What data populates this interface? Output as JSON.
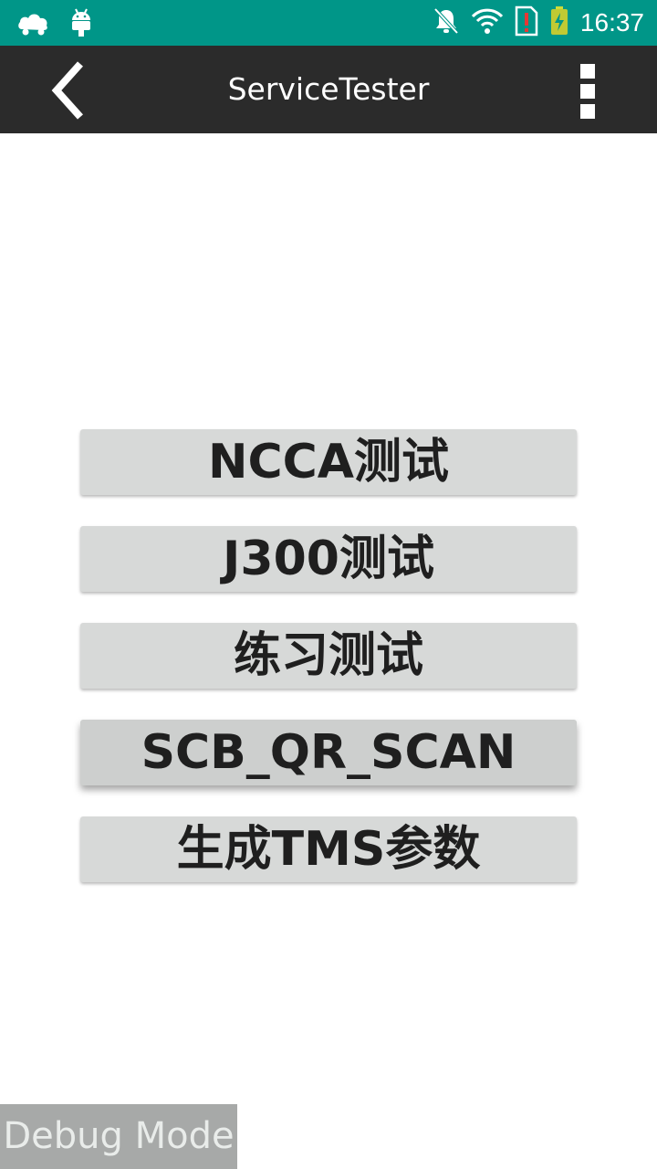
{
  "status_bar": {
    "time": "16:37",
    "icons": [
      "cloud-car-icon",
      "android-icon",
      "notifications-off-icon",
      "wifi-icon",
      "sim-alert-icon",
      "battery-charging-icon"
    ],
    "color": "#009688"
  },
  "toolbar": {
    "title": "ServiceTester",
    "back_icon": "chevron-left-icon",
    "overflow_icon": "more-vertical-icon",
    "color": "#2b2b2b"
  },
  "menu": {
    "buttons": [
      {
        "label": "NCCA测试"
      },
      {
        "label": "J300测试"
      },
      {
        "label": "练习测试"
      },
      {
        "label": "SCB_QR_SCAN"
      },
      {
        "label": "生成TMS参数"
      }
    ]
  },
  "debug": {
    "label": "Debug Mode"
  }
}
